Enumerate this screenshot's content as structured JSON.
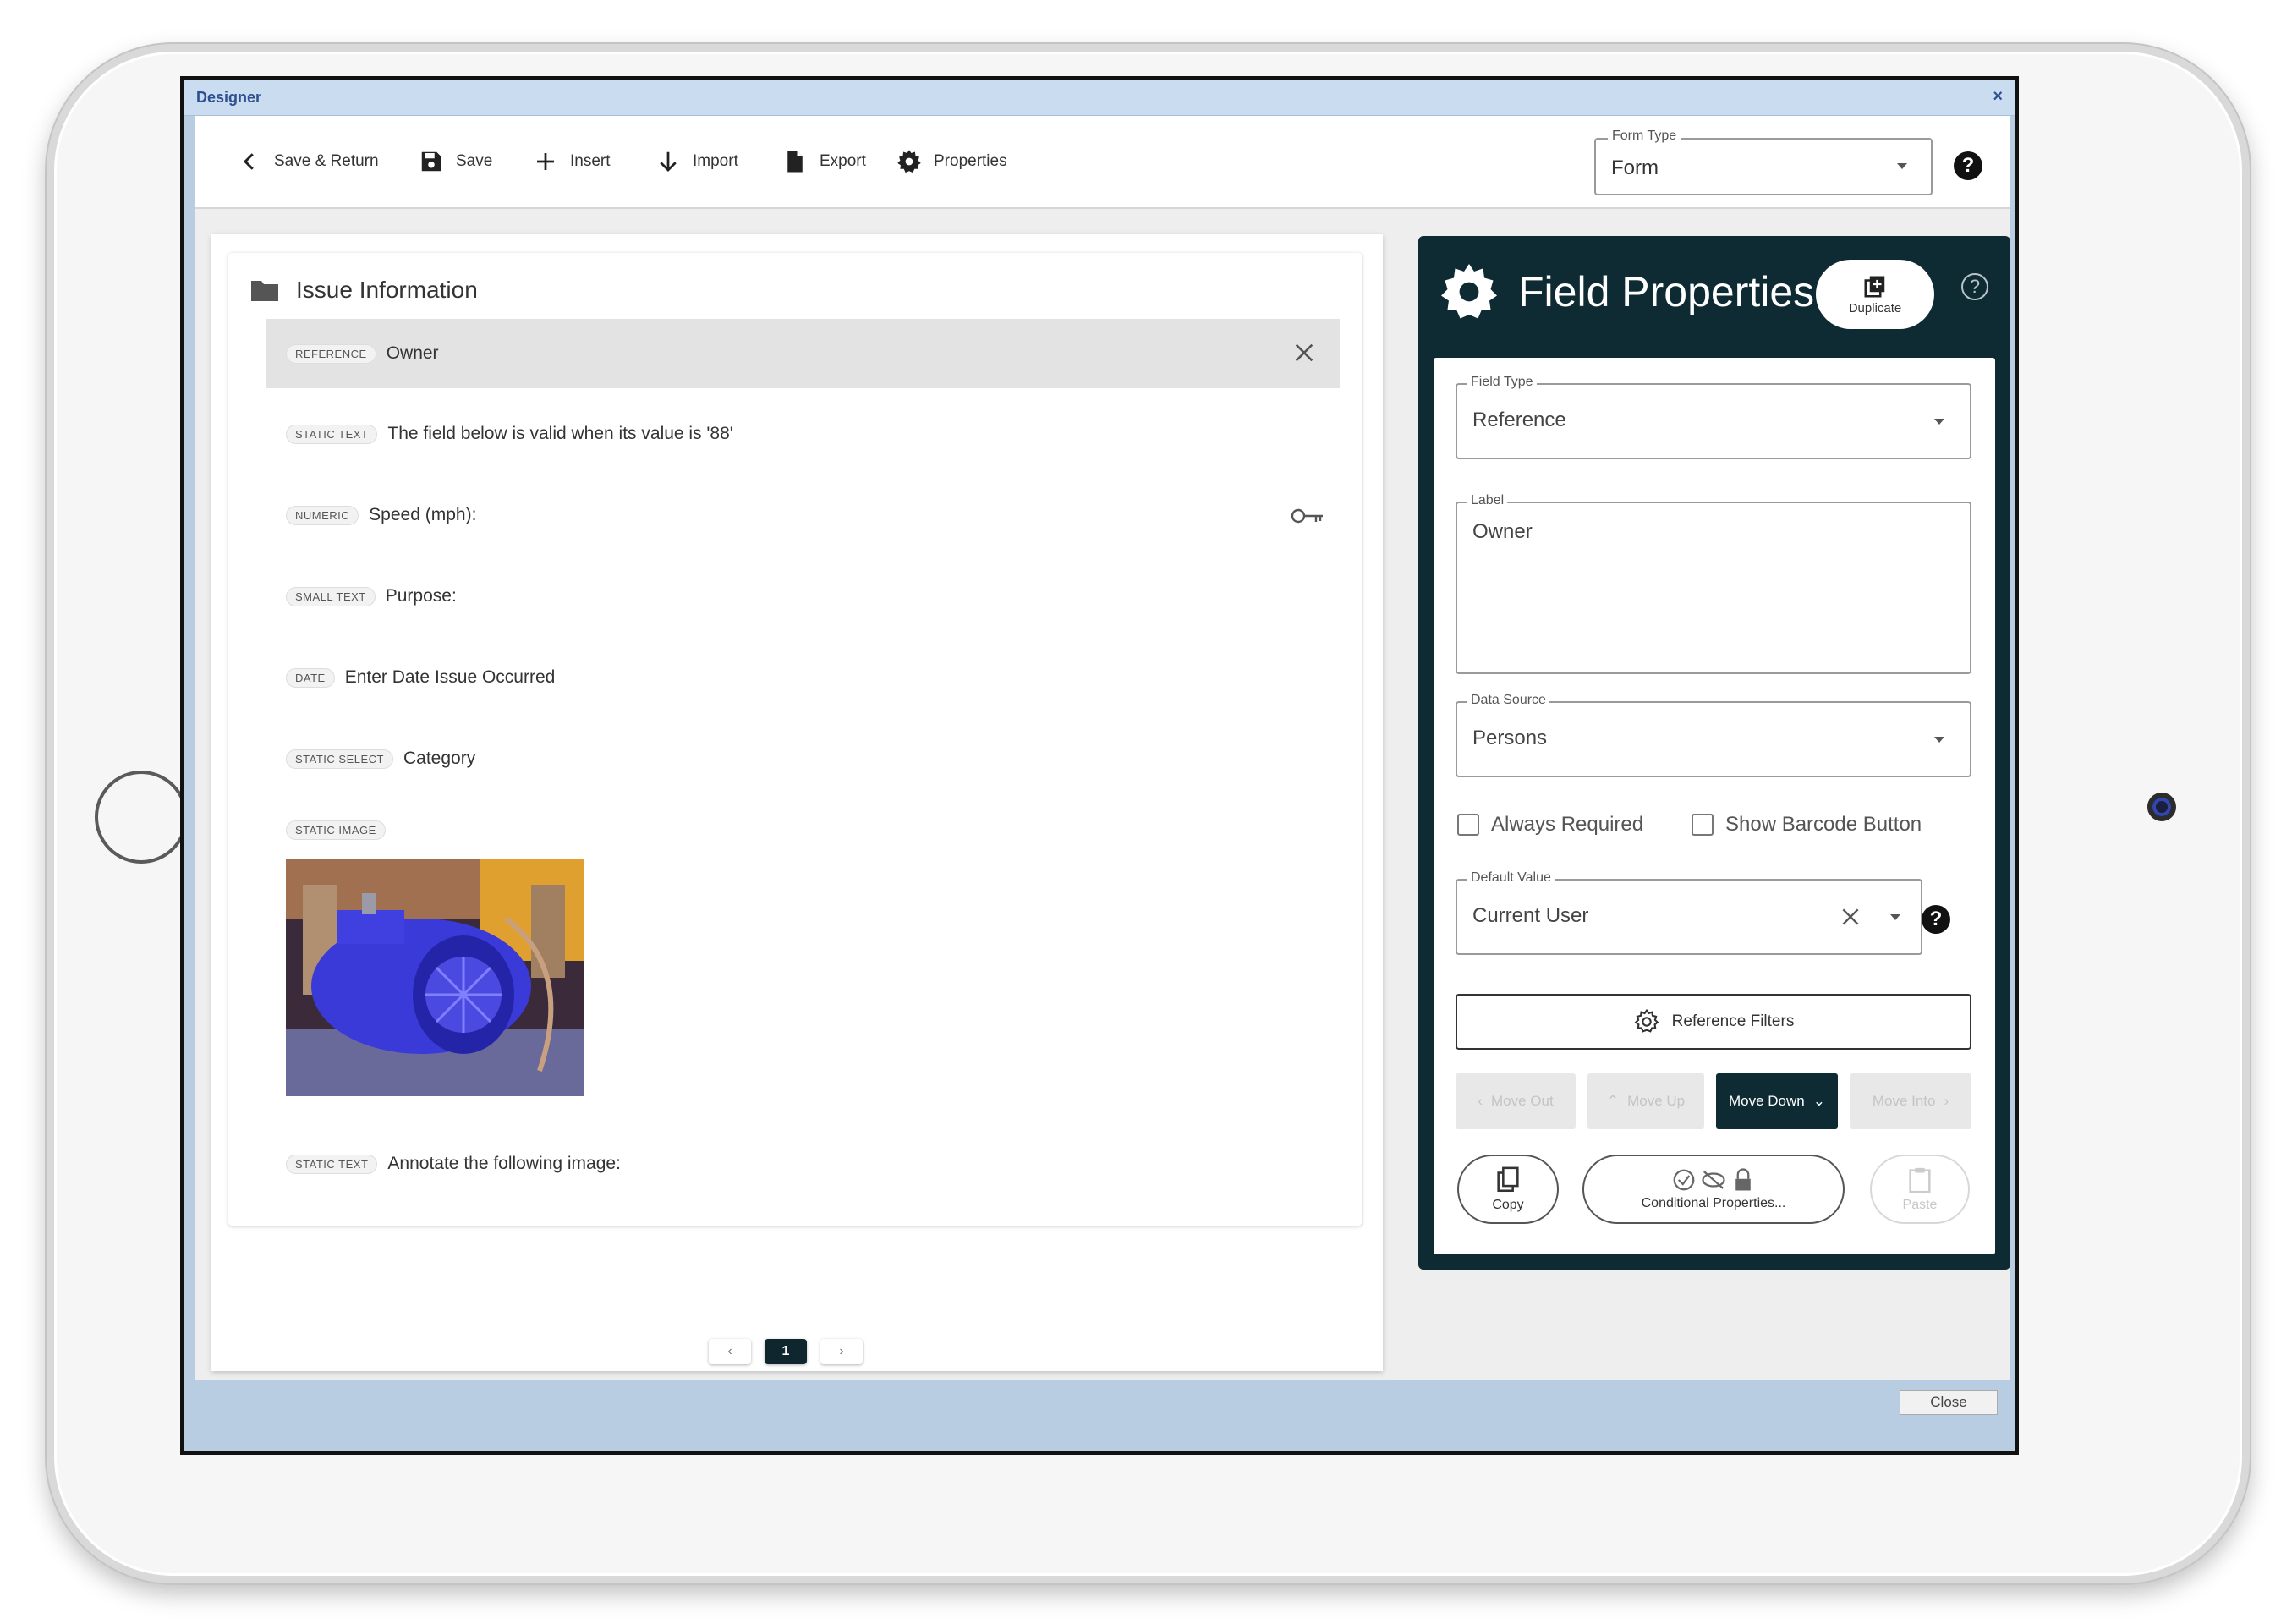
{
  "window": {
    "title": "Designer",
    "close_label": "×"
  },
  "toolbar": {
    "save_return": "Save & Return",
    "save": "Save",
    "insert": "Insert",
    "import": "Import",
    "export": "Export",
    "properties": "Properties"
  },
  "form_type": {
    "legend": "Form Type",
    "value": "Form"
  },
  "section": {
    "title": "Issue Information",
    "fields": [
      {
        "tag": "REFERENCE",
        "label": "Owner"
      },
      {
        "tag": "STATIC TEXT",
        "label": "The field below is valid when its value is '88'"
      },
      {
        "tag": "NUMERIC",
        "label": "Speed (mph):"
      },
      {
        "tag": "SMALL TEXT",
        "label": "Purpose:"
      },
      {
        "tag": "DATE",
        "label": "Enter Date Issue Occurred"
      },
      {
        "tag": "STATIC SELECT",
        "label": "Category"
      },
      {
        "tag": "STATIC IMAGE",
        "label": ""
      },
      {
        "tag": "STATIC TEXT",
        "label": "Annotate the following image:"
      }
    ]
  },
  "pager": {
    "prev": "‹",
    "current": "1",
    "next": "›"
  },
  "props": {
    "title": "Field Properties",
    "duplicate": "Duplicate",
    "help": "?",
    "field_type": {
      "legend": "Field Type",
      "value": "Reference"
    },
    "label": {
      "legend": "Label",
      "value": "Owner"
    },
    "data_source": {
      "legend": "Data Source",
      "value": "Persons"
    },
    "always_required": "Always Required",
    "show_barcode": "Show Barcode Button",
    "default_value": {
      "legend": "Default Value",
      "value": "Current User"
    },
    "reference_filters": "Reference Filters",
    "move_out": "Move Out",
    "move_up": "Move Up",
    "move_down": "Move Down",
    "move_into": "Move Into",
    "copy": "Copy",
    "conditional": "Conditional Properties...",
    "paste": "Paste"
  },
  "footer": {
    "close": "Close"
  },
  "colors": {
    "panel_dark": "#0e2a33",
    "window_blue": "#b8cde2",
    "selected_row": "#e3e3e3"
  }
}
